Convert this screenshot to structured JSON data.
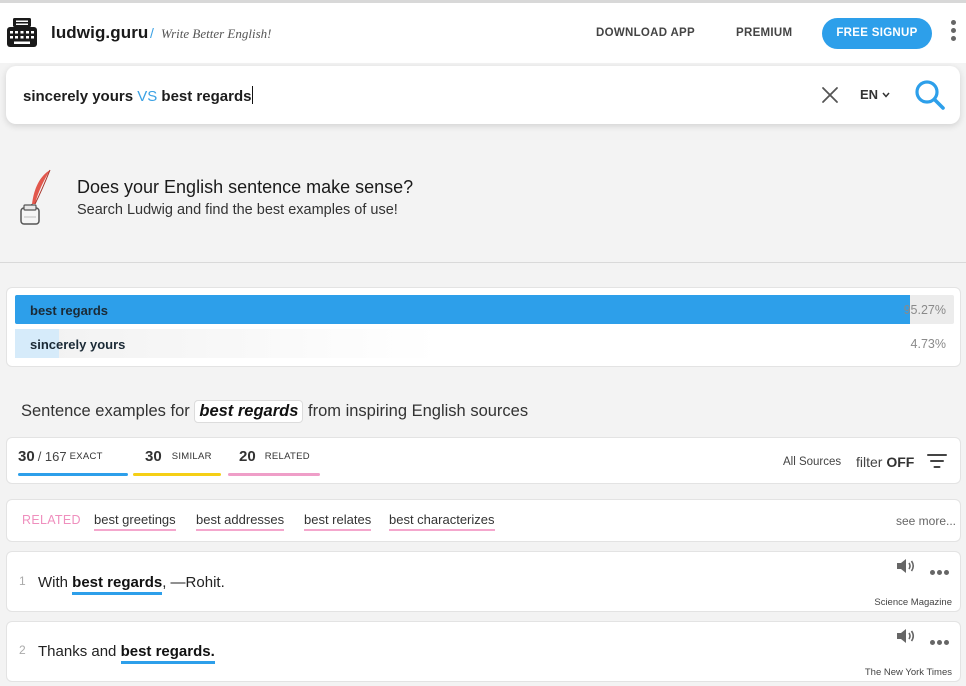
{
  "header": {
    "brand": "ludwig.guru",
    "separator": "/",
    "tagline": "Write Better English!",
    "nav_download": "DOWNLOAD APP",
    "nav_premium": "PREMIUM",
    "signup": "FREE SIGNUP",
    "logo_icon": "typewriter-icon",
    "menu_icon": "kebab-menu-icon"
  },
  "search": {
    "query_left": "sincerely yours",
    "query_vs": "VS",
    "query_right": "best regards",
    "clear_icon": "close-icon",
    "language": "EN",
    "search_icon": "search-icon"
  },
  "hero": {
    "title": "Does your English sentence make sense?",
    "subtitle": "Search Ludwig and find the best examples of use!",
    "icon": "quill-inkwell-icon"
  },
  "comparison": [
    {
      "label": "best regards",
      "percent_text": "95.27%",
      "share": 0.9527
    },
    {
      "label": "sincerely yours",
      "percent_text": "4.73%",
      "share": 0.0473
    }
  ],
  "examples_heading": {
    "prefix": "Sentence examples for",
    "term": "best regards",
    "suffix": "from inspiring English sources"
  },
  "filters": {
    "exact_count": "30",
    "exact_total": "/ 167",
    "exact_label": "EXACT",
    "similar_count": "30",
    "similar_label": "SIMILAR",
    "related_count": "20",
    "related_label": "RELATED",
    "all_sources": "All Sources",
    "filter_text": "filter",
    "filter_state": "OFF",
    "filter_icon": "filter-lines-icon"
  },
  "related": {
    "tag": "RELATED",
    "links": [
      "best greetings",
      "best addresses",
      "best relates",
      "best characterizes"
    ],
    "see_more": "see more..."
  },
  "examples": [
    {
      "index": "1",
      "before": "With ",
      "highlight": "best regards",
      "after": ", —Rohit.",
      "source": "Science Magazine"
    },
    {
      "index": "2",
      "before": "Thanks and ",
      "highlight": "best regards.",
      "after": "",
      "source": "The New York Times"
    }
  ],
  "colors": {
    "accent_blue": "#2d9fea",
    "similar_yellow": "#f5cf16",
    "related_pink": "#ef9ec8"
  }
}
